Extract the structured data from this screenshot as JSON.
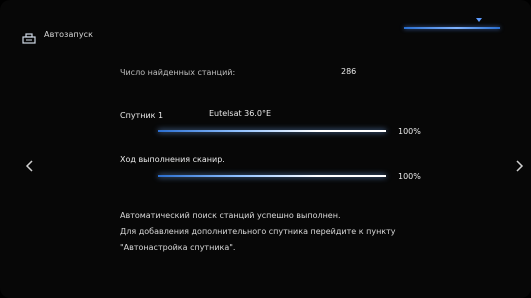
{
  "header": {
    "title": "Автозапуск",
    "icon": "satellite-icon"
  },
  "results": {
    "stations_found_label": "Число найденных станций:",
    "stations_found_value": "286",
    "satellite_label": "Спутник 1",
    "satellite_value": "Eutelsat 36.0°E",
    "satellite_progress": 1.0,
    "satellite_progress_text": "100%",
    "scan_label": "Ход выполнения сканир.",
    "scan_progress": 1.0,
    "scan_progress_text": "100%"
  },
  "message": {
    "line1": "Автоматический поиск станций успешно выполнен.",
    "line2": "Для добавления дополнительного спутника перейдите к пункту",
    "line3": "\"Автонастройка спутника\"."
  },
  "nav": {
    "left_icon": "chevron-left-icon",
    "right_icon": "chevron-right-icon"
  },
  "colors": {
    "background": "#070707",
    "accent": "#5d9bff",
    "text": "#e8e8e8"
  }
}
